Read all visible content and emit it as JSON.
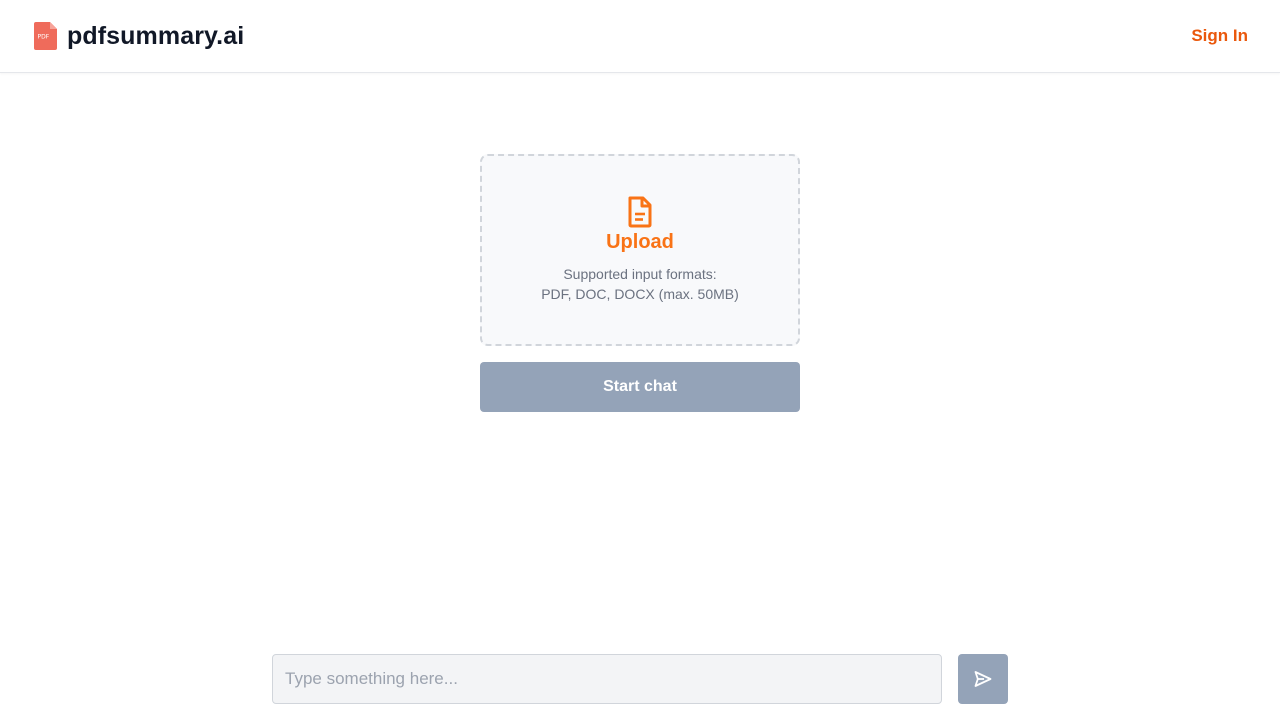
{
  "header": {
    "brand_name": "pdfsummary.ai",
    "logo_icon": "pdf-file-icon",
    "logo_text": "PDF",
    "sign_in_label": "Sign In"
  },
  "upload": {
    "icon": "document-icon",
    "label": "Upload",
    "formats_line1": "Supported input formats:",
    "formats_line2": "PDF, DOC, DOCX (max. 50MB)"
  },
  "start_chat_label": "Start chat",
  "chat": {
    "placeholder": "Type something here...",
    "value": "",
    "send_icon": "send-icon"
  },
  "colors": {
    "accent": "#ea580c",
    "upload_accent": "#f97316",
    "disabled_button": "#94a3b8",
    "logo_red": "#ef6b5b"
  }
}
